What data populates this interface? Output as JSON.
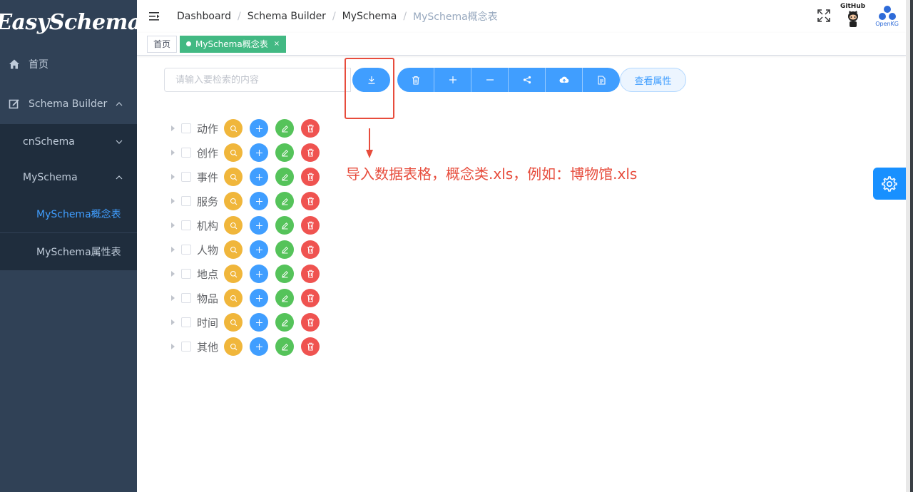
{
  "sidebar": {
    "logo": "EasySchema",
    "items": [
      {
        "label": "首页",
        "icon": "home-icon"
      },
      {
        "label": "Schema Builder",
        "icon": "edit-icon"
      }
    ],
    "sub": [
      {
        "label": "cnSchema"
      },
      {
        "label": "MySchema"
      }
    ],
    "leaf": [
      {
        "label": "MySchema概念表",
        "active": true
      },
      {
        "label": "MySchema属性表",
        "active": false
      }
    ]
  },
  "navbar": {
    "breadcrumb": [
      "Dashboard",
      "Schema Builder",
      "MySchema",
      "MySchema概念表"
    ],
    "github_label": "GitHub",
    "openkg_label": "OpenKG"
  },
  "tags": [
    {
      "label": "首页",
      "active": false
    },
    {
      "label": "MySchema概念表",
      "active": true,
      "close": "×"
    }
  ],
  "toolbar": {
    "search_placeholder": "请输入要检索的内容",
    "attr_button": "查看属性",
    "group_icons": [
      "trash-icon",
      "plus-icon",
      "minus-icon",
      "share-icon",
      "upload-cloud-icon",
      "document-icon"
    ]
  },
  "annotation": {
    "text": "导入数据表格，概念类.xls，例如：博物馆.xls",
    "color": "#e74c3c"
  },
  "tree": {
    "nodes": [
      "动作",
      "创作",
      "事件",
      "服务",
      "机构",
      "人物",
      "地点",
      "物品",
      "时间",
      "其他"
    ],
    "actions": [
      "search-icon",
      "plus-icon",
      "edit-icon",
      "trash-icon"
    ]
  },
  "colors": {
    "sidebar_bg": "#304156",
    "submenu_bg": "#1f2d3d",
    "primary": "#409eff",
    "tag_active": "#42b983"
  }
}
